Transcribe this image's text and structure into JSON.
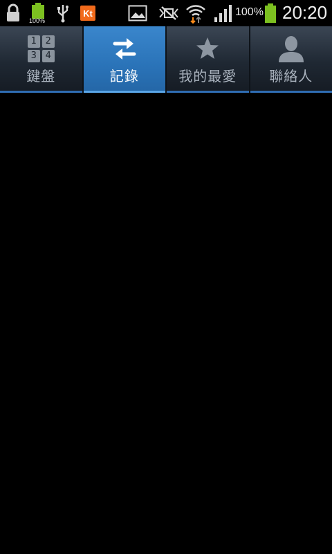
{
  "status_bar": {
    "icons": [
      "lock-icon",
      "battery-small-icon",
      "usb-icon",
      "kt-app-icon",
      "gallery-icon",
      "mute-icon",
      "wifi-icon",
      "signal-icon",
      "battery-icon"
    ],
    "mini_battery_label": "100%",
    "battery_percent": "100%",
    "time": "20:20",
    "kt_label": "Kt"
  },
  "tabs": [
    {
      "label": "鍵盤",
      "icon": "keypad-icon",
      "active": false,
      "keys": [
        "1",
        "2",
        "3",
        "4"
      ]
    },
    {
      "label": "記錄",
      "icon": "swap-arrows-icon",
      "active": true
    },
    {
      "label": "我的最愛",
      "icon": "star-icon",
      "active": false
    },
    {
      "label": "聯絡人",
      "icon": "person-icon",
      "active": false
    }
  ],
  "colors": {
    "active_tab": "#2a73b8",
    "tab_bar": "#1f2833",
    "battery_green": "#7cc020",
    "kt_orange": "#f26a1b"
  }
}
